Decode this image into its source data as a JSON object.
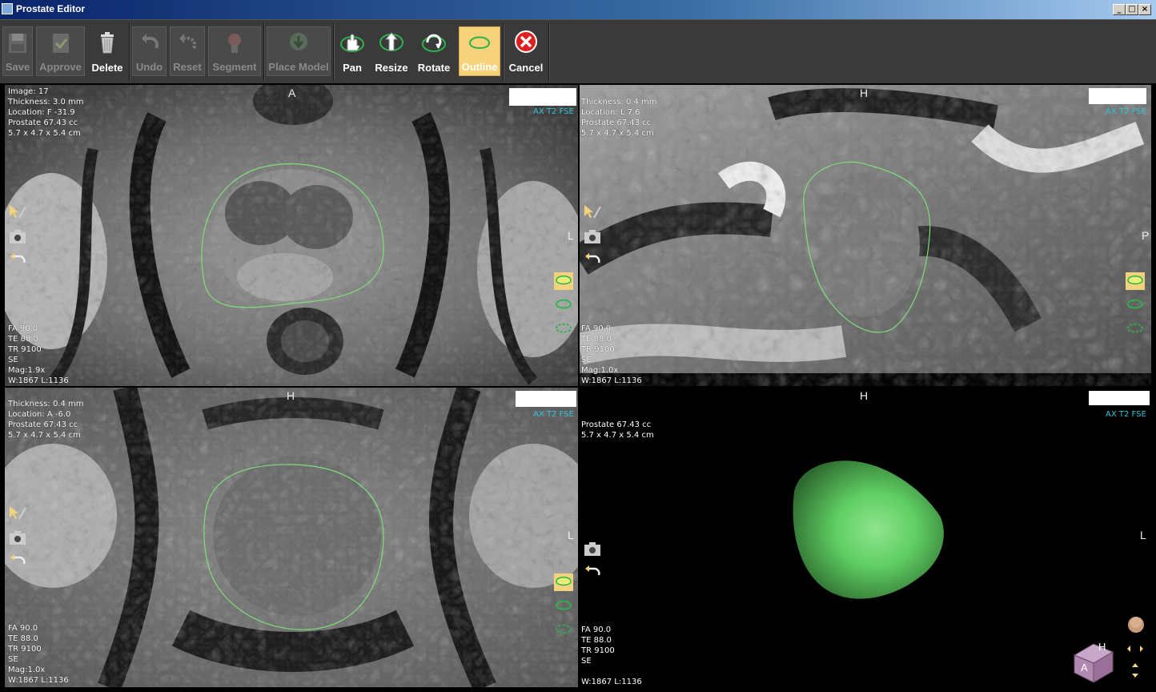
{
  "window": {
    "title": "Prostate Editor",
    "controls": [
      "_",
      "□",
      "×"
    ]
  },
  "toolbar": {
    "save": "Save",
    "approve": "Approve",
    "delete": "Delete",
    "undo": "Undo",
    "reset": "Reset",
    "segment": "Segment",
    "place_model": "Place Model",
    "pan": "Pan",
    "resize": "Resize",
    "rotate": "Rotate",
    "outline": "Outline",
    "cancel": "Cancel"
  },
  "colors": {
    "accent": "#f6d27a",
    "outline": "#7de07a",
    "series_label": "#35c4d8",
    "model": "#5fce62"
  },
  "views": {
    "axial": {
      "orientation_top": "A",
      "orientation_right": "L",
      "series": "AX T2 FSE",
      "info": [
        "Image: 17",
        "Thickness: 3.0 mm",
        "Location: F -31.9",
        "Prostate 67.43 cc",
        "5.7 x 4.7 x 5.4 cm"
      ],
      "params": [
        "FA 90.0",
        "TE 88.0",
        "TR 9100",
        "SE",
        "Mag:1.9x",
        "W:1867 L:1136"
      ]
    },
    "sagittal": {
      "orientation_top": "H",
      "orientation_right": "P",
      "series": "AX T2 FSE",
      "info": [
        "Thickness: 0.4 mm",
        "Location: L 7.6",
        "Prostate 67.43 cc",
        "5.7 x 4.7 x 5.4 cm"
      ],
      "params": [
        "FA 90.0",
        "TE 88.0",
        "TR 9100",
        "SE",
        "Mag:1.0x",
        "W:1867 L:1136"
      ]
    },
    "coronal": {
      "orientation_top": "H",
      "orientation_right": "L",
      "series": "AX T2 FSE",
      "info": [
        "Thickness: 0.4 mm",
        "Location: A -6.0",
        "Prostate 67.43 cc",
        "5.7 x 4.7 x 5.4 cm"
      ],
      "params": [
        "FA 90.0",
        "TE 88.0",
        "TR 9100",
        "SE",
        "Mag:1.0x",
        "W:1867 L:1136"
      ]
    },
    "model3d": {
      "orientation_top": "H",
      "orientation_right": "L",
      "series": "AX T2 FSE",
      "info": [
        "Prostate 67.43 cc",
        "5.7 x 4.7 x 5.4 cm"
      ],
      "params": [
        "FA 90.0",
        "TE 88.0",
        "TR 9100",
        "SE",
        "W:1867 L:1136"
      ],
      "cube_labels": [
        "H",
        "A"
      ]
    }
  }
}
